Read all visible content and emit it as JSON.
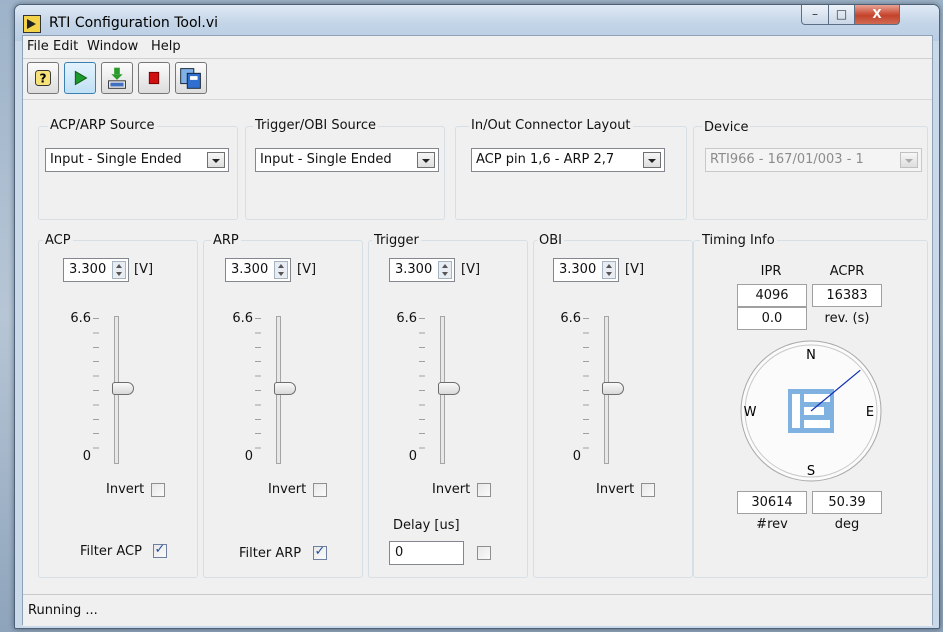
{
  "window": {
    "title": "RTI Configuration Tool.vi"
  },
  "title_buttons": {
    "minimize": "–",
    "maximize": "□",
    "close": "X"
  },
  "menu": [
    "File",
    "Edit",
    "Window",
    "Help"
  ],
  "toolbar": {
    "buttons": [
      "help-icon",
      "run-icon",
      "download-icon",
      "stop-icon",
      "copy-icon"
    ],
    "active": "run-icon",
    "colors": {
      "run": "#1e9a2c",
      "stop": "#d01010",
      "accent": "#3c7fb1"
    }
  },
  "sources": {
    "acp_arp": {
      "label": "ACP/ARP Source",
      "value": "Input - Single Ended"
    },
    "trigger_obi": {
      "label": "Trigger/OBI Source",
      "value": "Input - Single Ended"
    },
    "connector": {
      "label": "In/Out Connector Layout",
      "value": "ACP pin 1,6 - ARP 2,7"
    },
    "device": {
      "label": "Device",
      "value": "RTI966 - 167/01/003 - 1",
      "disabled": true
    }
  },
  "channels": [
    {
      "label": "ACP",
      "value": "3.300",
      "unit": "[V]",
      "scale_max": "6.6",
      "scale_min": "0",
      "invert_label": "Invert",
      "invert": false,
      "filter_label": "Filter ACP",
      "filter": true
    },
    {
      "label": "ARP",
      "value": "3.300",
      "unit": "[V]",
      "scale_max": "6.6",
      "scale_min": "0",
      "invert_label": "Invert",
      "invert": false,
      "filter_label": "Filter ARP",
      "filter": true
    },
    {
      "label": "Trigger",
      "value": "3.300",
      "unit": "[V]",
      "scale_max": "6.6",
      "scale_min": "0",
      "invert_label": "Invert",
      "invert": false,
      "delay_label": "Delay [us]",
      "delay_value": "0",
      "delay_enabled": false
    },
    {
      "label": "OBI",
      "value": "3.300",
      "unit": "[V]",
      "scale_max": "6.6",
      "scale_min": "0",
      "invert_label": "Invert",
      "invert": false
    }
  ],
  "timing": {
    "label": "Timing Info",
    "ipr_label": "IPR",
    "ipr_value": "4096",
    "acpr_label": "ACPR",
    "acpr_value": "16383",
    "rev_value": "0.0",
    "rev_label": "rev. (s)",
    "compass": {
      "north": "N",
      "east": "E",
      "south": "S",
      "west": "W",
      "heading_deg": 50.39,
      "needle_color": "#1030b0",
      "logo_color": "#7fb2e0"
    },
    "revs_value": "30614",
    "revs_label": "#rev",
    "deg_value": "50.39",
    "deg_label": "deg"
  },
  "status": {
    "text": "Running ..."
  }
}
